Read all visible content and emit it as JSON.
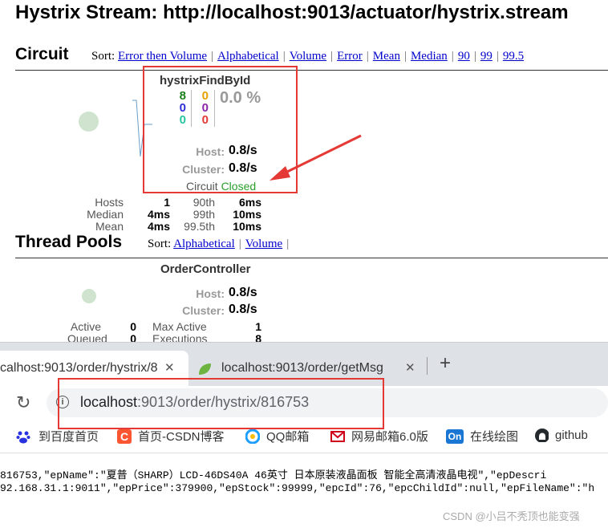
{
  "page": {
    "title": "Hystrix Stream: http://localhost:9013/actuator/hystrix.stream"
  },
  "circuit": {
    "heading": "Circuit",
    "sort_label": "Sort:",
    "sort_options": [
      "Error then Volume",
      "Alphabetical",
      "Volume",
      "Error",
      "Mean",
      "Median",
      "90",
      "99",
      "99.5"
    ],
    "card": {
      "name": "hystrixFindById",
      "counts": {
        "success": "8",
        "short_circuited": "0",
        "bad_request": "0",
        "timeout": "0",
        "rejected": "0",
        "failure": "0"
      },
      "error_pct": "0.0 %",
      "host_label": "Host:",
      "host_rate": "0.8/s",
      "cluster_label": "Cluster:",
      "cluster_rate": "0.8/s",
      "circuit_label": "Circuit",
      "circuit_status": "Closed",
      "hosts_label": "Hosts",
      "hosts_value": "1",
      "median_label": "Median",
      "median_value": "4ms",
      "mean_label": "Mean",
      "mean_value": "4ms",
      "p90_label": "90th",
      "p90_value": "6ms",
      "p99_label": "99th",
      "p99_value": "10ms",
      "p995_label": "99.5th",
      "p995_value": "10ms"
    }
  },
  "thread_pools": {
    "heading": "Thread Pools",
    "sort_label": "Sort:",
    "sort_options": [
      "Alphabetical",
      "Volume"
    ],
    "pool": {
      "name": "OrderController",
      "host_label": "Host:",
      "host_rate": "0.8/s",
      "cluster_label": "Cluster:",
      "cluster_rate": "0.8/s",
      "active_label": "Active",
      "active_value": "0",
      "queued_label": "Queued",
      "queued_value": "0",
      "max_active_label": "Max Active",
      "max_active_value": "1",
      "executions_label": "Executions",
      "executions_value": "8"
    }
  },
  "browser": {
    "tabs": [
      {
        "label": "calhost:9013/order/hystrix/8",
        "active": true
      },
      {
        "label": "localhost:9013/order/getMsg",
        "active": false
      }
    ],
    "new_tab_symbol": "+",
    "close_symbol": "✕",
    "reload_symbol": "↻",
    "info_symbol": "i",
    "url_host": "localhost",
    "url_rest": ":9013/order/hystrix/816753",
    "bookmarks": [
      {
        "label": "到百度首页",
        "icon": "baidu-icon",
        "color": "#2932e1"
      },
      {
        "label": "首页-CSDN博客",
        "icon": "csdn-icon",
        "color": "#fc5531"
      },
      {
        "label": "QQ邮箱",
        "icon": "qq-mail-icon",
        "color": "#1e9fff"
      },
      {
        "label": "网易邮箱6.0版",
        "icon": "netease-mail-icon",
        "color": "#d0021b"
      },
      {
        "label": "在线绘图",
        "icon": "online-draw-icon",
        "color": "#1976d2"
      },
      {
        "label": "github",
        "icon": "github-icon",
        "color": "#24292e"
      }
    ],
    "bookmark_badge_on": "On",
    "bookmark_badge_c": "C"
  },
  "response": {
    "line1": "816753,\"epName\":\"夏普（SHARP）LCD-46DS40A 46英寸 日本原装液晶面板 智能全高清液晶电视\",\"epDescri",
    "line2": "92.168.31.1:9011\",\"epPrice\":379900,\"epStock\":99999,\"epcId\":76,\"epcChildId\":null,\"epFileName\":\"h",
    "watermark": "CSDN @小吕不秃顶也能变强"
  },
  "colors": {
    "success": "#1b7e1b",
    "short_circuited": "#2f2fd6",
    "bad_request": "#26c6a0",
    "timeout": "#e6a100",
    "rejected": "#8e24aa",
    "failure": "#e53935",
    "closed": "#2aa02a",
    "annotation": "#e53935"
  }
}
